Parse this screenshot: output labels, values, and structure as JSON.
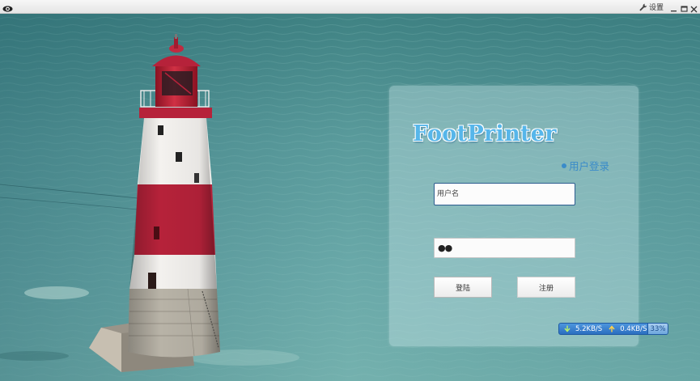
{
  "titlebar": {
    "app_icon": "eye-icon",
    "settings_icon": "wrench-icon",
    "settings_label": "设置",
    "minimize_icon": "minimize-icon",
    "maximize_icon": "maximize-icon",
    "close_icon": "close-icon"
  },
  "background": {
    "scene": "lighthouse-sea-photo",
    "sea_color": "#5d9fa0",
    "lighthouse_red": "#b6223a"
  },
  "login": {
    "logo_text": "FootPrinter",
    "section_title": "用户登录",
    "username_placeholder": "用户名",
    "username_value": "",
    "password_mask": "●●",
    "login_button": "登陆",
    "register_button": "注册",
    "accent_color": "#3a8bc9",
    "input_focus_border": "#2c5c8f"
  },
  "network_widget": {
    "download_icon": "arrow-down-icon",
    "download_speed": "5.2KB/S",
    "upload_icon": "arrow-up-icon",
    "upload_speed": "0.4KB/S",
    "usage_percent": "33%",
    "color": "#2b6fc0"
  }
}
